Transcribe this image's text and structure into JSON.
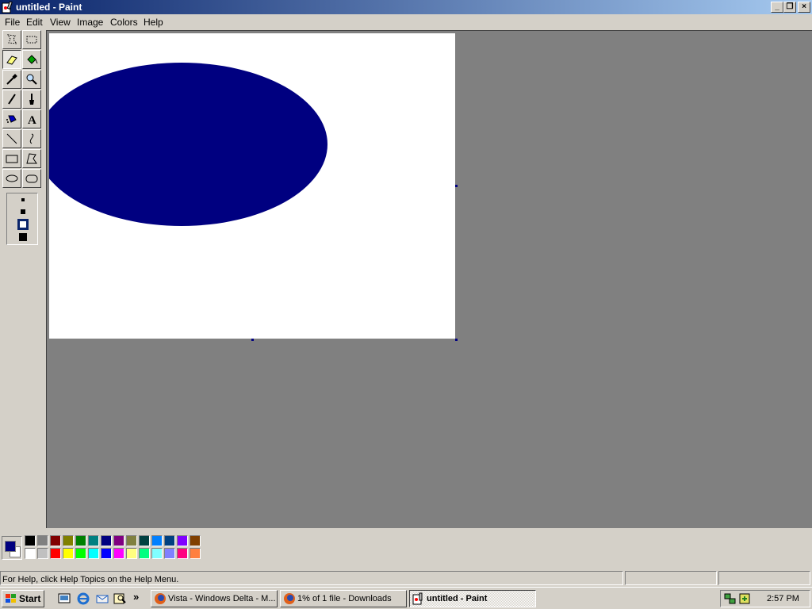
{
  "window": {
    "title": "untitled - Paint"
  },
  "menu": [
    "File",
    "Edit",
    "View",
    "Image",
    "Colors",
    "Help"
  ],
  "tools": [
    {
      "name": "free-form-select",
      "icon": "free-select-icon"
    },
    {
      "name": "select",
      "icon": "select-icon"
    },
    {
      "name": "eraser",
      "icon": "eraser-icon",
      "active": true
    },
    {
      "name": "fill-with-color",
      "icon": "fill-bucket-icon"
    },
    {
      "name": "pick-color",
      "icon": "eyedropper-icon"
    },
    {
      "name": "magnifier",
      "icon": "magnifier-icon"
    },
    {
      "name": "pencil",
      "icon": "pencil-icon"
    },
    {
      "name": "brush",
      "icon": "brush-icon"
    },
    {
      "name": "airbrush",
      "icon": "airbrush-icon"
    },
    {
      "name": "text",
      "icon": "text-icon",
      "glyph": "A"
    },
    {
      "name": "line",
      "icon": "line-icon"
    },
    {
      "name": "curve",
      "icon": "curve-icon"
    },
    {
      "name": "rectangle",
      "icon": "rectangle-icon"
    },
    {
      "name": "polygon",
      "icon": "polygon-icon"
    },
    {
      "name": "ellipse",
      "icon": "ellipse-icon"
    },
    {
      "name": "rounded-rectangle",
      "icon": "rounded-rectangle-icon"
    }
  ],
  "eraser_sizes": [
    "small",
    "medium",
    "large",
    "extra-large"
  ],
  "selected_eraser_size": 2,
  "canvas": {
    "shape_color": "#000080"
  },
  "colors": {
    "foreground": "#000080",
    "background": "#ffffff",
    "palette_top": [
      "#000000",
      "#808080",
      "#800000",
      "#808000",
      "#008000",
      "#008080",
      "#000080",
      "#800080",
      "#808040",
      "#004040",
      "#0080ff",
      "#004080",
      "#8000ff",
      "#804000"
    ],
    "palette_bottom": [
      "#ffffff",
      "#c0c0c0",
      "#ff0000",
      "#ffff00",
      "#00ff00",
      "#00ffff",
      "#0000ff",
      "#ff00ff",
      "#ffff80",
      "#00ff80",
      "#80ffff",
      "#8080ff",
      "#ff0080",
      "#ff8040"
    ]
  },
  "status": {
    "help_text": "For Help, click Help Topics on the Help Menu."
  },
  "taskbar": {
    "start_label": "Start",
    "quick_launch": [
      "show-desktop-icon",
      "internet-explorer-icon",
      "outlook-express-icon",
      "search-icon"
    ],
    "overflow_label": "»",
    "tasks": [
      {
        "label": "Vista - Windows Delta - M...",
        "icon": "firefox-icon"
      },
      {
        "label": "1% of 1 file - Downloads",
        "icon": "firefox-icon"
      },
      {
        "label": "untitled - Paint",
        "icon": "paint-icon",
        "active": true
      }
    ],
    "clock": "2:57 PM"
  }
}
